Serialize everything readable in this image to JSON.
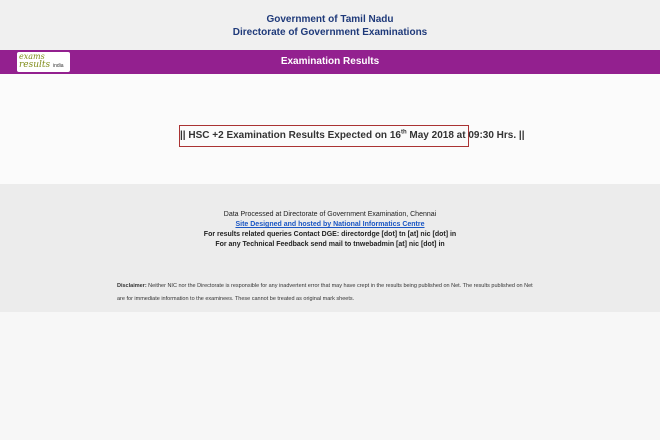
{
  "header": {
    "line1": "Government of Tamil Nadu",
    "line2": "Directorate of Government Examinations"
  },
  "banner": {
    "logo_word1": "exams",
    "logo_word2": "results",
    "logo_word3": "india",
    "title": "Examination Results",
    "color": "#93208f"
  },
  "notice": {
    "prefix": "|| HSC +2 Examination Results Expected on 16",
    "sup": "th",
    "suffix": " May 2018 at 09:30 Hrs. ||"
  },
  "footer": {
    "processed": "Data Processed at Directorate of Government Examination, Chennai",
    "site_link": "Site Designed and hosted by National Informatics Centre",
    "contact": "For results related queries Contact DGE:  directordge [dot] tn [at] nic [dot] in",
    "feedback": "For any Technical Feedback send mail to tnwebadmin [at] nic [dot] in",
    "disclaimer_label": "Disclaimer:",
    "disclaimer_text": " Neither NIC nor the Directorate is responsible for any inadvertent error that may have crept in the results being published on Net. The results published on Net are for immediate information to the examinees. These cannot be treated as original mark sheets."
  }
}
